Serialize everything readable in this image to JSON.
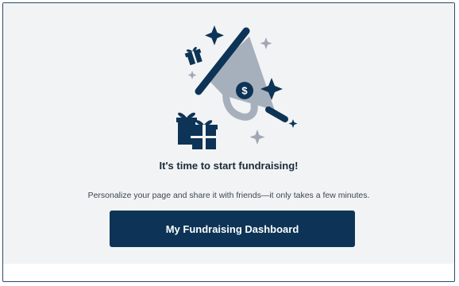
{
  "empty_state": {
    "headline": "It's time to start fundraising!",
    "subtext": "Personalize your page and share it with friends—it only takes a few minutes.",
    "cta_label": "My Fundraising Dashboard"
  },
  "illustration": {
    "icons": [
      "megaphone-icon",
      "dollar-coin-icon",
      "gift-box-icon",
      "sparkle-icon"
    ],
    "coin_symbol": "$"
  },
  "colors": {
    "navy": "#0d3456",
    "megaphone_gray": "#a6b0bc",
    "sparkle_light": "#a0a8b4",
    "card_background": "#f2f3f4",
    "frame_border": "#2c4a68"
  }
}
